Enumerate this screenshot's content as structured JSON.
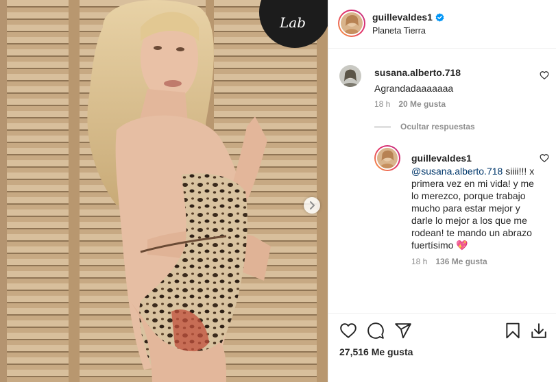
{
  "post": {
    "username": "guillevaldes1",
    "location": "Planeta Tierra",
    "verified": true,
    "likes": "27,516",
    "likes_label": "Me gusta"
  },
  "comments": [
    {
      "author": "susana.alberto.718",
      "text": "Agrandadaaaaaaa",
      "time": "18 h",
      "likes": "20 Me gusta"
    }
  ],
  "hide_replies_label": "Ocultar respuestas",
  "reply": {
    "author": "guillevaldes1",
    "mention": "@susana.alberto.718",
    "text": " siiii!!! x primera vez en mi vida! y me lo merezco, porque trabajo mucho para estar mejor y darle lo mejor a los que me rodean! te mando un abrazo fuertísimo 💖",
    "time": "18 h",
    "likes": "136 Me gusta"
  },
  "photo_sign_text": "Lab",
  "colors": {
    "verified_blue": "#0095f6",
    "mention": "#00376b",
    "secondary_text": "#8e8e8e",
    "ring_gradient": [
      "#f9a13a",
      "#e1306c",
      "#c13584"
    ]
  },
  "icons": [
    "verified-badge-icon",
    "heart-icon",
    "comment-icon",
    "share-icon",
    "save-icon",
    "download-icon",
    "chevron-right-icon"
  ]
}
